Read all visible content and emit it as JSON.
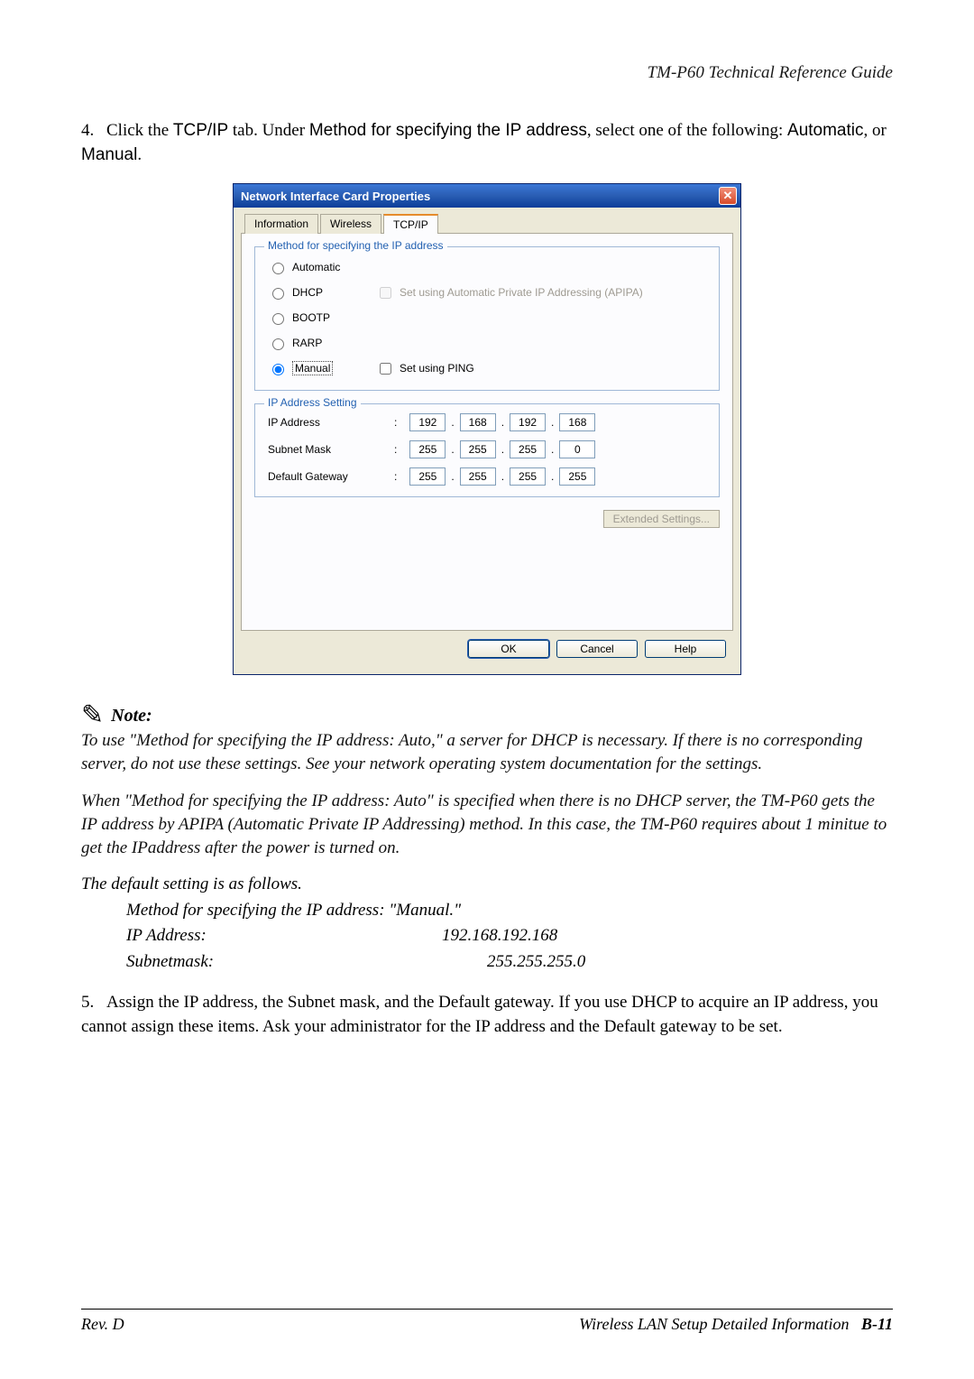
{
  "header": {
    "title": "TM-P60 Technical Reference Guide"
  },
  "step4": {
    "num": "4.",
    "prefix": "Click the ",
    "tcp": "TCP/IP",
    "mid1": " tab. Under ",
    "method": "Method for specifying the IP address",
    "mid2": ", select one of the following: ",
    "auto": "Automatic",
    "mid3": ", or ",
    "manual": "Manual",
    "end": "."
  },
  "dialog": {
    "title": "Network Interface Card Properties",
    "tabs": {
      "info": "Information",
      "wireless": "Wireless",
      "tcpip": "TCP/IP"
    },
    "method_group": "Method for specifying the IP address",
    "radios": {
      "automatic": "Automatic",
      "dhcp": "DHCP",
      "bootp": "BOOTP",
      "rarp": "RARP",
      "manual": "Manual"
    },
    "apipa_label": "Set using Automatic Private IP Addressing (APIPA)",
    "ping_label": "Set using PING",
    "ip_group": "IP Address Setting",
    "rows": {
      "ip": {
        "label": "IP Address",
        "o1": "192",
        "o2": "168",
        "o3": "192",
        "o4": "168"
      },
      "mask": {
        "label": "Subnet Mask",
        "o1": "255",
        "o2": "255",
        "o3": "255",
        "o4": "0"
      },
      "gw": {
        "label": "Default Gateway",
        "o1": "255",
        "o2": "255",
        "o3": "255",
        "o4": "255"
      }
    },
    "extended": "Extended Settings...",
    "ok": "OK",
    "cancel": "Cancel",
    "help": "Help"
  },
  "note": {
    "label": "Note:",
    "p1": "To use \"Method for specifying the IP address: Auto,\"  a server for DHCP is necessary. If there is no corresponding server, do not use these settings. See your network operating system documentation for the settings.",
    "p2": "When \"Method for specifying the IP address: Auto\" is specified when there is no DHCP server, the TM-P60 gets the IP address by APIPA (Automatic Private IP Addressing) method. In this case, the TM-P60 requires about 1 minitue to get the IPaddress after the power is turned on.",
    "defaults_head": "The default setting is as follows.",
    "method_line": "Method for specifying the IP address: \"Manual.\"",
    "ip_lbl": "IP Address:",
    "ip_val": "192.168.192.168",
    "mask_lbl": " Subnetmask:",
    "mask_val": "255.255.255.0"
  },
  "step5": {
    "num": "5.",
    "text": "Assign the IP address, the Subnet mask, and the Default gateway. If you use DHCP to acquire an IP address, you cannot assign these items. Ask your administrator for the IP address and the Default gateway to be set."
  },
  "footer": {
    "left": "Rev. D",
    "right_text": "Wireless LAN Setup Detailed Information",
    "right_page": "B-11"
  }
}
